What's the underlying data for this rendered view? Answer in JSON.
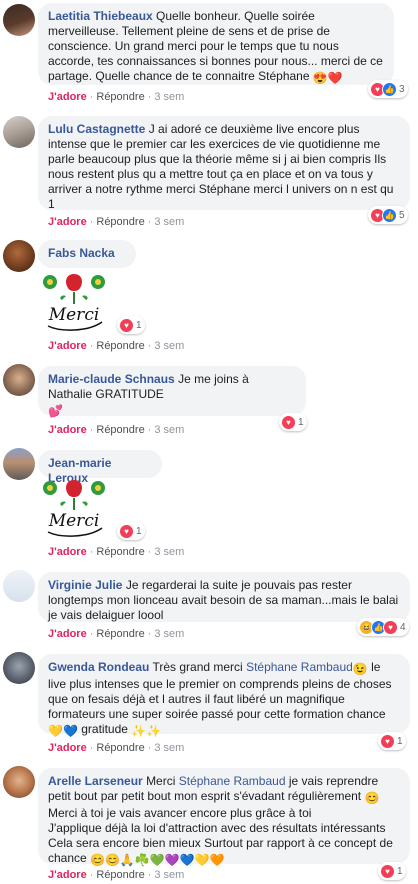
{
  "actions": {
    "like": "J'adore",
    "reply": "Répondre",
    "separator": "·"
  },
  "comments": [
    {
      "author": "Laetitia Thiebeaux",
      "text": "Quelle bonheur. Quelle soirée merveilleuse. Tellement pleine de sens et de prise de conscience. Un grand merci pour le temps que tu nous accorde, tes connaissances si bonnes pour nous... merci de ce partage. Quelle chance de te connaitre Stéphane",
      "emoji": "😍❤️",
      "time": "3 sem",
      "reaction_count": "3"
    },
    {
      "author": "Lulu Castagnette",
      "text": "J ai adoré ce deuxième live encore plus intense que le premier car les exercices de vie quotidienne me parle beaucoup plus que la théorie même si j ai bien compris Ils nous restent plus qu a mettre tout ça en place et on va tous y arriver a notre rythme merci Stéphane merci l univers on n est qu 1",
      "time": "3 sem",
      "reaction_count": "5"
    },
    {
      "author": "Fabs Nacka",
      "sticker_text": "Merci",
      "time": "3 sem",
      "reaction_count": "1"
    },
    {
      "author": "Marie-claude Schnaus",
      "text": "Je me joins à Nathalie GRATITUDE",
      "emoji": "💕",
      "time": "3 sem",
      "reaction_count": "1"
    },
    {
      "author": "Jean-marie Leroux",
      "sticker_text": "Merci",
      "time": "3 sem",
      "reaction_count": "1"
    },
    {
      "author": "Virginie Julie",
      "text": "Je regarderai la suite je pouvais pas rester longtemps mon lionceau avait besoin de sa maman...mais le balai je vais delaiguer loool",
      "time": "3 sem",
      "reaction_count": "4"
    },
    {
      "author": "Gwenda Rondeau",
      "text_before": "Très grand merci",
      "mention": "Stéphane Rambaud",
      "text_after": "le live plus intenses que le premier on comprends pleins de choses que on fesais déjà et l autres il faut libéré un magnifique formateurs une super soirée passé pour cette formation chance",
      "emoji_mid": "😉",
      "emoji_end": "💛💙",
      "gratitude": "gratitude",
      "emoji_tail": "✨✨",
      "time": "3 sem",
      "reaction_count": "1"
    },
    {
      "author": "Arelle Larseneur",
      "text_before": "Merci",
      "mention": "Stéphane Rambaud",
      "text_mid": "je vais reprendre petit bout par petit bout mon esprit s'évadant régulièrement",
      "emoji_mid": "😊",
      "line2": "Merci à toi je vais avancer encore plus grâce à toi",
      "line3": "J'applique déjà la loi d'attraction avec des résultats intéressants Cela sera encore bien mieux Surtout par rapport à ce concept de chance",
      "emoji_end": "😊😊🙏☘️💚💜💙💛🧡",
      "time": "3 sem",
      "reaction_count": "1"
    }
  ],
  "colors": {
    "author": "#385898",
    "like": "#e0245e",
    "bubble": "#f2f3f5",
    "love": "#f33e58",
    "like_blue": "#2078f4"
  },
  "icons": [
    "love-reaction-icon",
    "like-reaction-icon",
    "haha-reaction-icon",
    "rose-sticker"
  ]
}
